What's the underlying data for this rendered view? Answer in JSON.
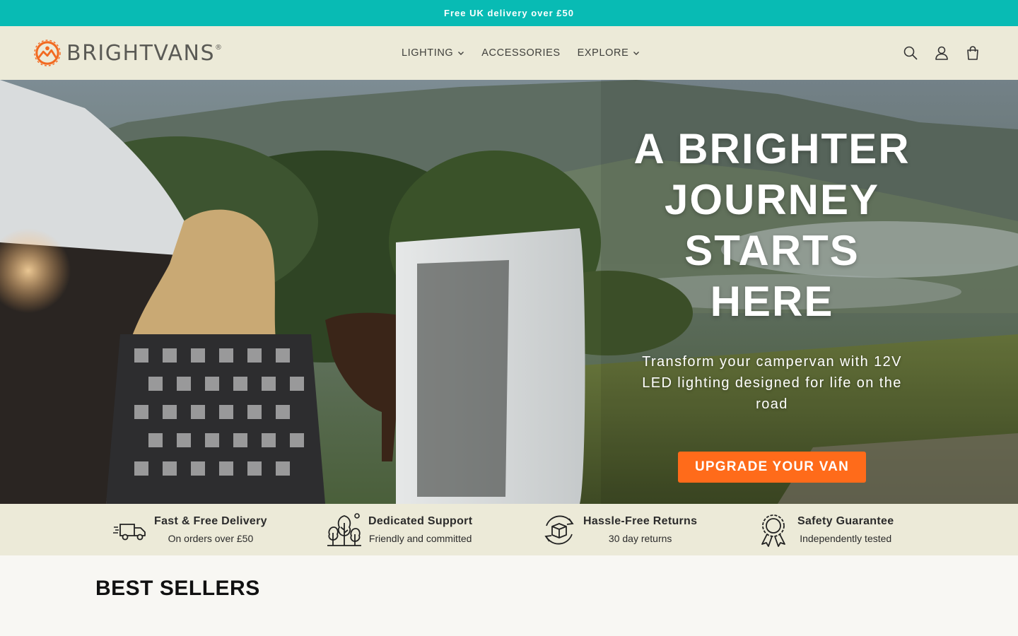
{
  "announcement": "Free UK delivery over £50",
  "brand": {
    "name": "BRIGHTVANS",
    "mark": "®",
    "accent": "#f26a21"
  },
  "nav": [
    {
      "label": "LIGHTING",
      "dropdown": true
    },
    {
      "label": "ACCESSORIES",
      "dropdown": false
    },
    {
      "label": "EXPLORE",
      "dropdown": true
    }
  ],
  "header_icons": [
    "search-icon",
    "account-icon",
    "cart-icon"
  ],
  "hero": {
    "title_lines": [
      "A BRIGHTER",
      "JOURNEY",
      "STARTS HERE"
    ],
    "subtitle": "Transform your campervan with 12V LED lighting designed for life on the road",
    "cta": "UPGRADE YOUR VAN"
  },
  "features": [
    {
      "icon": "delivery-van-icon",
      "title": "Fast & Free Delivery",
      "desc": "On orders over £50"
    },
    {
      "icon": "trees-icon",
      "title": "Dedicated Support",
      "desc": "Friendly and committed"
    },
    {
      "icon": "returns-box-icon",
      "title": "Hassle-Free Returns",
      "desc": "30 day returns"
    },
    {
      "icon": "award-ribbon-icon",
      "title": "Safety Guarantee",
      "desc": "Independently tested"
    }
  ],
  "section_title": "BEST SELLERS",
  "colors": {
    "announcement_bg": "#08bbb4",
    "header_bg": "#ecead8",
    "cta_bg": "#ff6b1a"
  }
}
